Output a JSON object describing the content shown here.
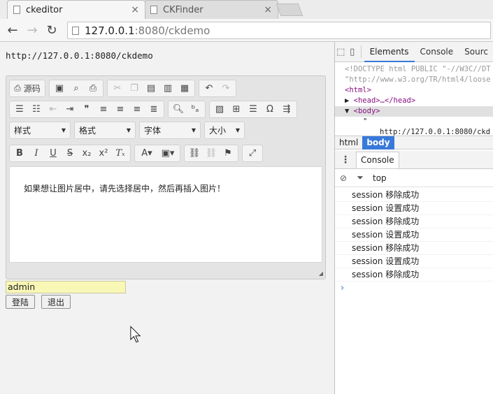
{
  "browser": {
    "tabs": [
      {
        "label": "ckeditor",
        "close": "×"
      },
      {
        "label": "CKFinder",
        "close": "×"
      }
    ],
    "nav": {
      "back": "←",
      "forward": "→",
      "reload": "↻"
    },
    "url_host": "127.0.0.1",
    "url_rest": ":8080/ckdemo"
  },
  "page": {
    "url_text": "http://127.0.0.1:8080/ckdemo",
    "editor": {
      "source_label": "源码",
      "combos": [
        "样式",
        "格式",
        "字体",
        "大小"
      ],
      "content": "如果想让图片居中，请先选择居中，然后再插入图片！"
    },
    "username_value": "admin",
    "login_label": "登陆",
    "logout_label": "退出"
  },
  "devtools": {
    "tabs": [
      "Elements",
      "Console",
      "Sourc"
    ],
    "dom_lines": [
      "<!DOCTYPE html PUBLIC \"-//W3C//DT",
      "\"http://www.w3.org/TR/html4/loose",
      "<html>",
      "<head>…</head>",
      "<body>",
      "\"",
      "http://127.0.0.1:8080/ckd"
    ],
    "breadcrumbs": [
      "html",
      "body"
    ],
    "drawer_tab": "Console",
    "context": "top",
    "logs": [
      "session 移除成功",
      "session 设置成功",
      "session 移除成功",
      "session 设置成功",
      "session 移除成功",
      "session 设置成功",
      "session 移除成功"
    ],
    "prompt": "›"
  }
}
